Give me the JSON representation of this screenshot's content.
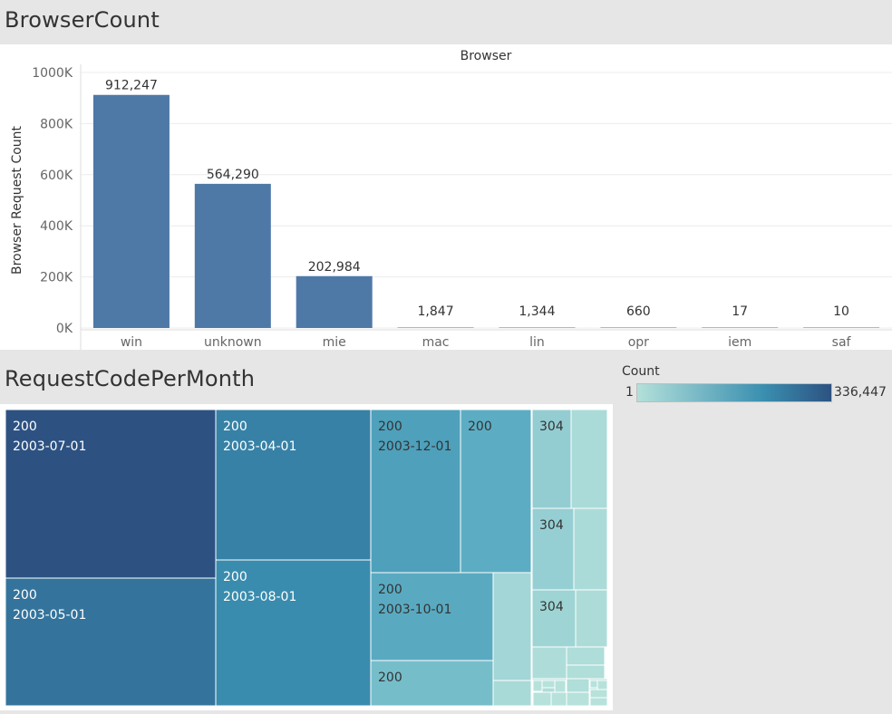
{
  "sheets": {
    "browser_title": "BrowserCount",
    "request_title": "RequestCodePerMonth"
  },
  "colors": {
    "bar": "#4e79a7",
    "ramp_low": "#b3e0da",
    "ramp_mid": "#3a8fb0",
    "ramp_high": "#2d5282"
  },
  "chart_data": [
    {
      "type": "bar",
      "title": "Browser",
      "xlabel": "",
      "ylabel": "Browser Request Count",
      "categories": [
        "win",
        "unknown",
        "mie",
        "mac",
        "lin",
        "opr",
        "iem",
        "saf"
      ],
      "values": [
        912247,
        564290,
        202984,
        1847,
        1344,
        660,
        17,
        10
      ],
      "data_labels": [
        "912,247",
        "564,290",
        "202,984",
        "1,847",
        "1,344",
        "660",
        "17",
        "10"
      ],
      "ylim": [
        0,
        1000000
      ],
      "yticks": [
        {
          "value": 0,
          "label": "0K"
        },
        {
          "value": 200000,
          "label": "200K"
        },
        {
          "value": 400000,
          "label": "400K"
        },
        {
          "value": 600000,
          "label": "600K"
        },
        {
          "value": 800000,
          "label": "800K"
        },
        {
          "value": 1000000,
          "label": "1000K"
        }
      ],
      "grid": true
    },
    {
      "type": "treemap",
      "color_legend": {
        "title": "Count",
        "min": 1,
        "max": 336447,
        "min_label": "1",
        "max_label": "336,447"
      },
      "cells": [
        {
          "code": "200",
          "month": "2003-07-01",
          "count": 336447
        },
        {
          "code": "200",
          "month": "2003-05-01",
          "count": 270000
        },
        {
          "code": "200",
          "month": "2003-04-01",
          "count": 245000
        },
        {
          "code": "200",
          "month": "2003-08-01",
          "count": 225000
        },
        {
          "code": "200",
          "month": "2003-12-01",
          "count": 165000
        },
        {
          "code": "200",
          "month": "",
          "count": 125000
        },
        {
          "code": "200",
          "month": "2003-10-01",
          "count": 135000
        },
        {
          "code": "200",
          "month": "",
          "count": 85000
        },
        {
          "code": "304",
          "month": "",
          "count": 45000
        },
        {
          "code": "304",
          "month": "",
          "count": 40000
        },
        {
          "code": "304",
          "month": "",
          "count": 30000
        }
      ]
    }
  ]
}
